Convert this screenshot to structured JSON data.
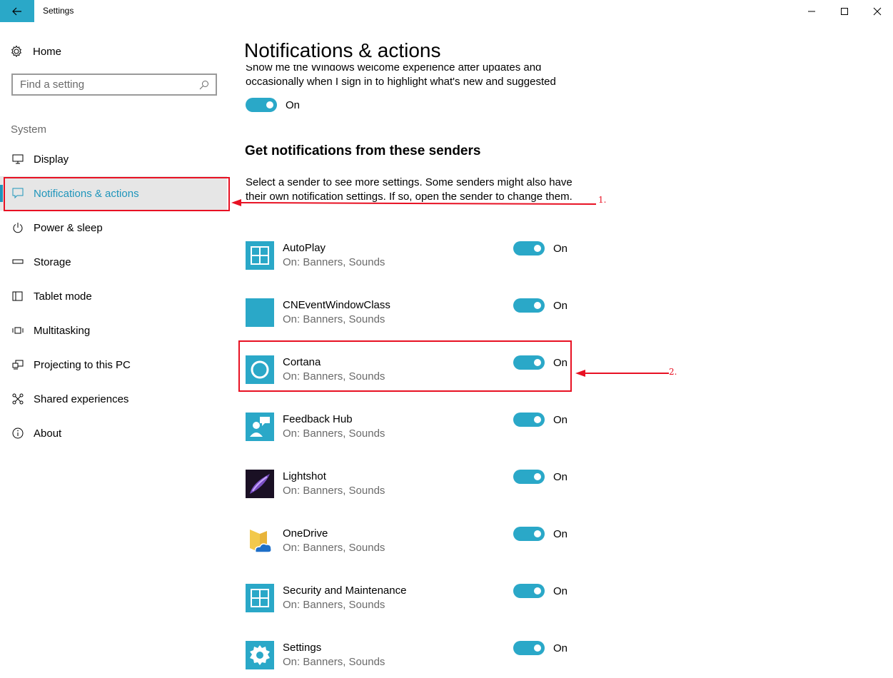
{
  "window": {
    "title": "Settings",
    "controls": [
      "minimize",
      "maximize",
      "close"
    ]
  },
  "sidebar": {
    "home_label": "Home",
    "search_placeholder": "Find a setting",
    "section_label": "System",
    "items": [
      {
        "label": "Display",
        "icon": "monitor-icon"
      },
      {
        "label": "Notifications & actions",
        "icon": "chat-bubble-icon",
        "selected": true
      },
      {
        "label": "Power & sleep",
        "icon": "power-icon"
      },
      {
        "label": "Storage",
        "icon": "storage-icon"
      },
      {
        "label": "Tablet mode",
        "icon": "tablet-icon"
      },
      {
        "label": "Multitasking",
        "icon": "multitasking-icon"
      },
      {
        "label": "Projecting to this PC",
        "icon": "projecting-icon"
      },
      {
        "label": "Shared experiences",
        "icon": "share-icon"
      },
      {
        "label": "About",
        "icon": "info-icon"
      }
    ]
  },
  "main": {
    "title": "Notifications & actions",
    "welcome_text": "Show me the Windows welcome experience after updates and occasionally when I sign in to highlight what's new and suggested",
    "welcome_toggle_state": "On",
    "senders_heading": "Get notifications from these senders",
    "senders_description": "Select a sender to see more settings. Some senders might also have their own notification settings. If so, open the sender to change them.",
    "senders": [
      {
        "name": "AutoPlay",
        "sub": "On: Banners, Sounds",
        "state": "On",
        "icon": "autoplay-icon"
      },
      {
        "name": "CNEventWindowClass",
        "sub": "On: Banners, Sounds",
        "state": "On",
        "icon": "blank-app-icon"
      },
      {
        "name": "Cortana",
        "sub": "On: Banners, Sounds",
        "state": "On",
        "icon": "cortana-icon"
      },
      {
        "name": "Feedback Hub",
        "sub": "On: Banners, Sounds",
        "state": "On",
        "icon": "feedback-hub-icon"
      },
      {
        "name": "Lightshot",
        "sub": "On: Banners, Sounds",
        "state": "On",
        "icon": "lightshot-icon"
      },
      {
        "name": "OneDrive",
        "sub": "On: Banners, Sounds",
        "state": "On",
        "icon": "onedrive-icon"
      },
      {
        "name": "Security and Maintenance",
        "sub": "On: Banners, Sounds",
        "state": "On",
        "icon": "security-maintenance-icon"
      },
      {
        "name": "Settings",
        "sub": "On: Banners, Sounds",
        "state": "On",
        "icon": "settings-gear-icon"
      }
    ]
  },
  "annotations": {
    "label_1": "1.",
    "label_2": "2."
  },
  "colors": {
    "accent": "#2aa8c8",
    "selected_text": "#1f95bb",
    "annotation": "#e81123"
  }
}
